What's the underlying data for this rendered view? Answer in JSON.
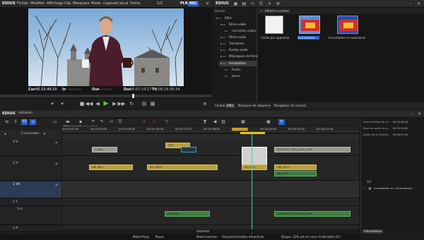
{
  "player": {
    "app": "EDIUS",
    "menu": [
      "Fichier",
      "Modifier",
      "Affichage",
      "Clip",
      "Marqueur",
      "Mode",
      "Capture",
      "Calcul",
      "Outils"
    ],
    "page": "1/2",
    "plr": "PLR",
    "rec": "REC",
    "cur_label": "Cur",
    "cur_tc": "00:15:49:10",
    "in_label": "In",
    "in_tc": "--:--:--:--",
    "out_label": "Out",
    "out_tc": "--:--:--:--",
    "dur_label": "Dur",
    "dur_tc": "00:07:10:17",
    "ttl_label": "Ttl",
    "ttl_tc": "00:16:39:34"
  },
  "bin": {
    "app": "EDIUS",
    "folder_label": "Dossier",
    "path": "Effet/Incrustation",
    "tree": [
      {
        "label": "Effet",
        "level": 0
      },
      {
        "label": "Filtres vidéo",
        "level": 1
      },
      {
        "label": "Correction coleur",
        "level": 2
      },
      {
        "label": "Filtres audio",
        "level": 1
      },
      {
        "label": "Transitions",
        "level": 1
      },
      {
        "label": "Fondus audio",
        "level": 1
      },
      {
        "label": "Mélangeurs de titres",
        "level": 1
      },
      {
        "label": "Incrustation",
        "level": 1
      },
      {
        "label": "Fusion",
        "level": 2
      },
      {
        "label": "perso",
        "level": 1
      }
    ],
    "items": [
      {
        "label": "Cache par approche"
      },
      {
        "label": "Incrustation ..."
      },
      {
        "label": "Incrustation en luminance"
      }
    ],
    "tabs": [
      "Chutier",
      "Effet",
      "Marqueur de séquence",
      "Navigateur de sources"
    ]
  },
  "timeline": {
    "app": "EDIUS",
    "project": "Initiation",
    "tabs": [
      "Séquence1",
      "correction"
    ],
    "scale": "2 secondes",
    "ruler": [
      "00:14:51:00",
      "00:15:00:00",
      "00:15:09:00",
      "00:15:18:00",
      "00:15:27:00",
      "00:15:36:00",
      "00:15:45:00",
      "00:15:54:00",
      "00:16:03:00",
      "00:16:12:00"
    ],
    "tracks": [
      "3 V",
      "2 V",
      "1 VA",
      "1 T",
      "1 A",
      "2 A",
      "3 A",
      "4 A"
    ],
    "clips": [
      {
        "label": "MTS",
        "track": "3 V"
      },
      {
        "label": "20150327_0001_0001_0033",
        "track": "2 V"
      },
      {
        "label": "L_0021",
        "track": "2 V"
      },
      {
        "label": "NIK_8027",
        "track": "1 VA"
      },
      {
        "label": "A05_8023",
        "track": "1 VA"
      },
      {
        "label": "A0_8027",
        "track": "1 VA"
      },
      {
        "label": "DSC_8027",
        "track": "1 VA"
      },
      {
        "label": "OA_0071",
        "track": "1 A"
      },
      {
        "label": "20150327_0001_0001_0004",
        "track": "2 A"
      },
      {
        "label": "OA_0071",
        "track": "2 A"
      }
    ]
  },
  "info": {
    "rows": [
      {
        "label": "Point d'entrée de la f...",
        "value": "00:15:46:10"
      },
      {
        "label": "Point de sortie de la ...",
        "value": "00:15:54:02"
      },
      {
        "label": "Durée de la timeline",
        "value": "00:00:07:42"
      }
    ],
    "count": "1/1",
    "effect": "Incrustation en chrominance",
    "tab": "Informations"
  },
  "status": {
    "proxy": "Mode Proxy",
    "pause": "Pause",
    "insert": "Mode Insertion",
    "resync": "Resynchronisation désactivée",
    "disk": "Disque :32% est en cours d'utilisation (D:)"
  }
}
